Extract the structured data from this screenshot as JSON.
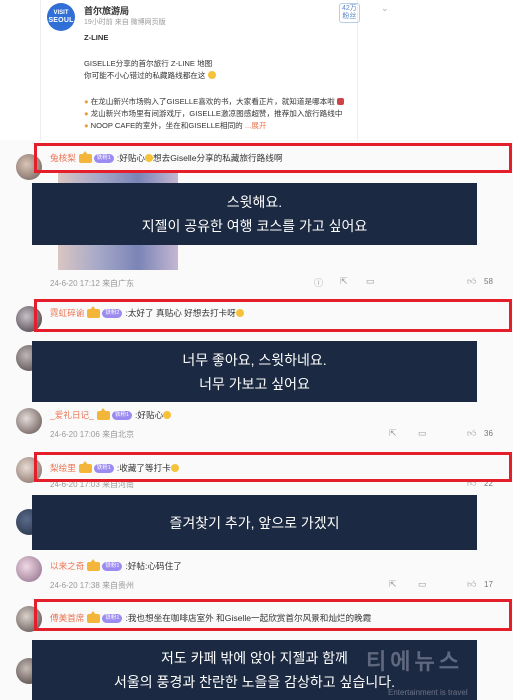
{
  "post": {
    "logo_small": "VISIT",
    "logo_big": "SEOUL",
    "account_name": "首尔旅游局",
    "meta": "19小时前  来自 微博网页版",
    "follower_badge": "42万\n粉丝",
    "title_line": "Z-LINE",
    "lines": [
      "GISELLE分享的首尔旅行 Z-LINE 地图",
      "你可能不小心错过的私藏路线都在这"
    ],
    "bullets": [
      "在龙山新兴市场购入了GISELLE喜欢的书，大家看正片，就知道是哪本啦",
      "龙山新兴市场里有间游戏厅，GISELLE激凉图感超赞，推荐加入旅行路线中",
      "NOOP CAFE的室外，坐在和GISELLE相同的"
    ],
    "expand": "...展开"
  },
  "comments": [
    {
      "username": "兔核梨",
      "fan_label": "铁粉1",
      "text": ":好贴心",
      "text_after": "想去Giselle分享的私藏旅行路线啊",
      "date": "24-6-20 17:12",
      "source": "来自广东",
      "likes": "58",
      "subtitle": [
        "스윗해요.",
        "지젤이 공유한 여행 코스를 가고 싶어요"
      ]
    },
    {
      "username": "霓虹碎谕",
      "fan_label": "铁粉2",
      "text": ":太好了 真贴心 好想去打卡呀",
      "date": "",
      "source": "",
      "likes": "",
      "subtitle": [
        "너무 좋아요, 스윗하네요.",
        "너무 가보고 싶어요"
      ]
    },
    {
      "username": "_爱礼日记_",
      "fan_label": "铁粉1",
      "text": ":好贴心",
      "date": "24-6-20 17:06",
      "source": "来自北京",
      "likes": "36",
      "subtitle": []
    },
    {
      "username": "梨绘里",
      "fan_label": "铁粉1",
      "text": ":收藏了等打卡",
      "date": "24-6-20 17:03",
      "source": "来自河南",
      "likes": "22",
      "subtitle": [
        "즐겨찾기 추가, 앞으로 가겠지"
      ]
    },
    {
      "username": "以来之奇",
      "fan_label": "铁粉1",
      "text": ":好帖:心码住了",
      "date": "24-6-20 17:38",
      "source": "来自贵州",
      "likes": "17",
      "subtitle": []
    },
    {
      "username": "傅美首席",
      "fan_label": "铁粉1",
      "text": ":我也想坐在咖啡店室外 和Giselle一起欣赏首尔风景和灿烂的晚霞",
      "date": "",
      "source": "",
      "likes": "",
      "subtitle": [
        "저도 카페 밖에 앉아 지젤과 함께",
        "서울의 풍경과 찬란한 노을을 감상하고 싶습니다."
      ]
    }
  ],
  "watermark": {
    "main": "티에뉴스",
    "sub": "Entertainment is travel"
  }
}
